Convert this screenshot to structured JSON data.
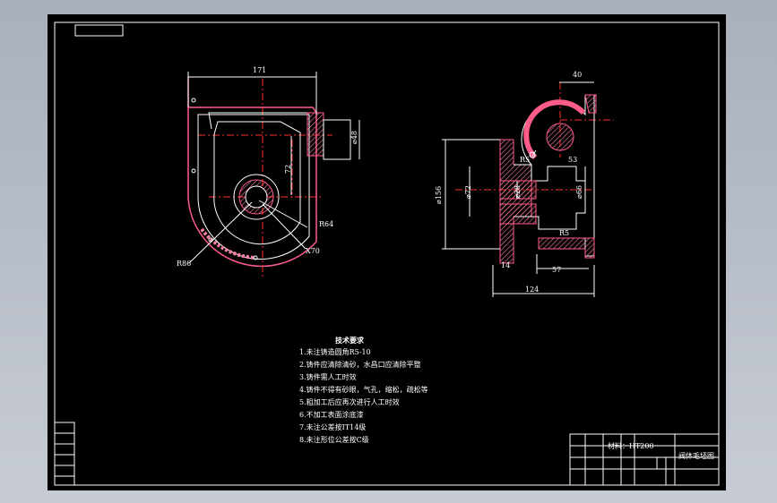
{
  "colors": {
    "background": "#b8bec8",
    "sheet": "#000000",
    "line": "#ffffff",
    "centerline": "#ff2d2d",
    "hatch": "#ff7fa0",
    "contour": "#ff5c8a"
  },
  "dimensions": {
    "d171": "171",
    "d72": "72",
    "d48": "⌀48",
    "r64": "R64",
    "r70": "X70",
    "r86": "R86",
    "d40": "40",
    "r5a": "R5",
    "d53": "53",
    "d156": "⌀156",
    "d72b": "⌀72",
    "d28": "⌀28",
    "d66": "⌀66",
    "r5b": "R5",
    "d14": "14",
    "d57": "57",
    "d124": "124"
  },
  "requirements": {
    "title": "技术要求",
    "items": [
      "1.未注铸造圆角R5-10",
      "2.铸件应清除清砂，水昌口应清除平整",
      "3.铸件需人工时效",
      "4.铸件不得有砂眼，气孔，缩松，疏松等",
      "5.粗加工后应再次进行人工时效",
      "6.不加工表面涂底漆",
      "7.未注公差按IT14级",
      "8.未注形位公差按C级"
    ]
  },
  "title_block": {
    "material": "材料：HT200",
    "part_name": "阀体毛坯图"
  }
}
